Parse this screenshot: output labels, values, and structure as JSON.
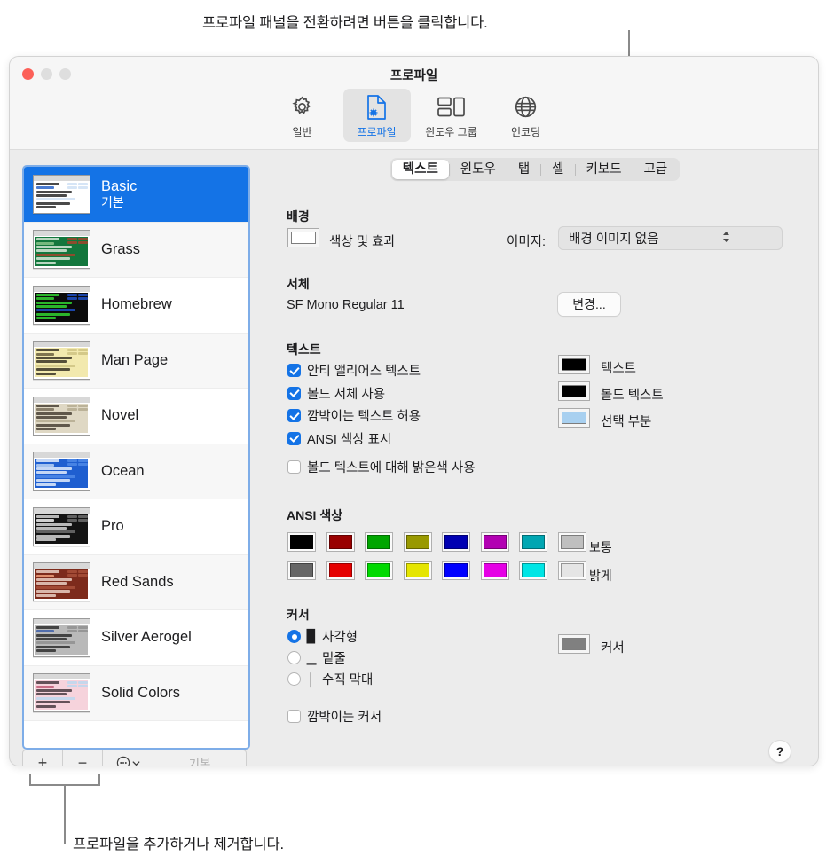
{
  "callouts": {
    "top": "프로파일 패널을 전환하려면 버튼을 클릭합니다.",
    "bottom": "프로파일을 추가하거나 제거합니다."
  },
  "window": {
    "title": "프로파일",
    "traffic_lights": [
      "close-red",
      "minimize-gray",
      "zoom-gray"
    ]
  },
  "toolbar": {
    "items": [
      {
        "label": "일반",
        "icon": "gear-icon",
        "selected": false
      },
      {
        "label": "프로파일",
        "icon": "profile-document-icon",
        "selected": true
      },
      {
        "label": "윈도우 그룹",
        "icon": "window-groups-icon",
        "selected": false
      },
      {
        "label": "인코딩",
        "icon": "globe-icon",
        "selected": false
      }
    ]
  },
  "sidebar": {
    "profiles": [
      {
        "name": "Basic",
        "subtitle": "기본",
        "selected": true,
        "thumb": {
          "bg": "#ffffff",
          "fg": "#2a2a2a",
          "accent": "#cfe0f5",
          "hl": "#2a64c8"
        }
      },
      {
        "name": "Grass",
        "subtitle": "",
        "selected": false,
        "thumb": {
          "bg": "#13773d",
          "fg": "#d8e8d8",
          "accent": "#a2442c",
          "hl": "#8ac48a"
        }
      },
      {
        "name": "Homebrew",
        "subtitle": "",
        "selected": false,
        "thumb": {
          "bg": "#0b0b0b",
          "fg": "#31d431",
          "accent": "#1f4fc4",
          "hl": "#31d431"
        }
      },
      {
        "name": "Man Page",
        "subtitle": "",
        "selected": false,
        "thumb": {
          "bg": "#f2e9ae",
          "fg": "#3a3426",
          "accent": "#cfc382",
          "hl": "#6b6040"
        }
      },
      {
        "name": "Novel",
        "subtitle": "",
        "selected": false,
        "thumb": {
          "bg": "#dfd8c4",
          "fg": "#4a4236",
          "accent": "#b5ab91",
          "hl": "#7a705c"
        }
      },
      {
        "name": "Ocean",
        "subtitle": "",
        "selected": false,
        "thumb": {
          "bg": "#1f5fd0",
          "fg": "#e2ecfb",
          "accent": "#4f8ae8",
          "hl": "#b9d2f5"
        }
      },
      {
        "name": "Pro",
        "subtitle": "",
        "selected": false,
        "thumb": {
          "bg": "#141414",
          "fg": "#d5d5d5",
          "accent": "#6e6e6e",
          "hl": "#f0f0f0"
        }
      },
      {
        "name": "Red Sands",
        "subtitle": "",
        "selected": false,
        "thumb": {
          "bg": "#7d2b1c",
          "fg": "#e9cfc3",
          "accent": "#a8503a",
          "hl": "#f0a07a"
        }
      },
      {
        "name": "Silver Aerogel",
        "subtitle": "",
        "selected": false,
        "thumb": {
          "bg": "#b9b9b9",
          "fg": "#2e2e2e",
          "accent": "#8f8f8f",
          "hl": "#3e5fa8"
        }
      },
      {
        "name": "Solid Colors",
        "subtitle": "",
        "selected": false,
        "thumb": {
          "bg": "#f6d3dc",
          "fg": "#4a3b42",
          "accent": "#bcd7ef",
          "hl": "#c05a76"
        }
      }
    ],
    "toolbar": {
      "add_label": "+",
      "remove_label": "−",
      "action_label": "⋯",
      "default_label": "기본"
    }
  },
  "panel": {
    "tabs": [
      {
        "label": "텍스트",
        "active": true
      },
      {
        "label": "윈도우",
        "active": false
      },
      {
        "label": "탭",
        "active": false
      },
      {
        "label": "셀",
        "active": false
      },
      {
        "label": "키보드",
        "active": false
      },
      {
        "label": "고급",
        "active": false
      }
    ],
    "background": {
      "section": "배경",
      "color_effects_label": "색상 및 효과",
      "color_well": "#ffffff",
      "image_label": "이미지:",
      "image_value": "배경 이미지 없음"
    },
    "font": {
      "section": "서체",
      "value": "SF Mono Regular 11",
      "change_button": "변경..."
    },
    "text": {
      "section": "텍스트",
      "checkboxes": [
        {
          "label": "안티 앨리어스 텍스트",
          "checked": true
        },
        {
          "label": "볼드 서체 사용",
          "checked": true
        },
        {
          "label": "깜박이는 텍스트 허용",
          "checked": true
        },
        {
          "label": "ANSI 색상 표시",
          "checked": true
        },
        {
          "label": "볼드 텍스트에 대해 밝은색 사용",
          "checked": false
        }
      ],
      "wells": [
        {
          "label": "텍스트",
          "color": "#000000"
        },
        {
          "label": "볼드 텍스트",
          "color": "#000000"
        },
        {
          "label": "선택 부분",
          "color": "#a8d0f0"
        }
      ]
    },
    "ansi": {
      "section": "ANSI 색상",
      "normal_label": "보통",
      "bright_label": "밝게",
      "normal": [
        "#000000",
        "#990000",
        "#00a600",
        "#999900",
        "#0000b2",
        "#b200b2",
        "#00a6b2",
        "#bfbfbf"
      ],
      "bright": [
        "#666666",
        "#e50000",
        "#00d900",
        "#e5e500",
        "#0000ff",
        "#e500e5",
        "#00e5e5",
        "#e5e5e5"
      ]
    },
    "cursor": {
      "section": "커서",
      "options": [
        {
          "label": "사각형",
          "glyph": "block-cursor-icon",
          "glyph_char": "▉",
          "selected": true
        },
        {
          "label": "밑줄",
          "glyph": "underline-cursor-icon",
          "glyph_char": "▁",
          "selected": false
        },
        {
          "label": "수직 막대",
          "glyph": "bar-cursor-icon",
          "glyph_char": "│",
          "selected": false
        }
      ],
      "blink_label": "깜박이는 커서",
      "blink_checked": false,
      "well_label": "커서",
      "well_color": "#808080"
    },
    "help_label": "?"
  }
}
